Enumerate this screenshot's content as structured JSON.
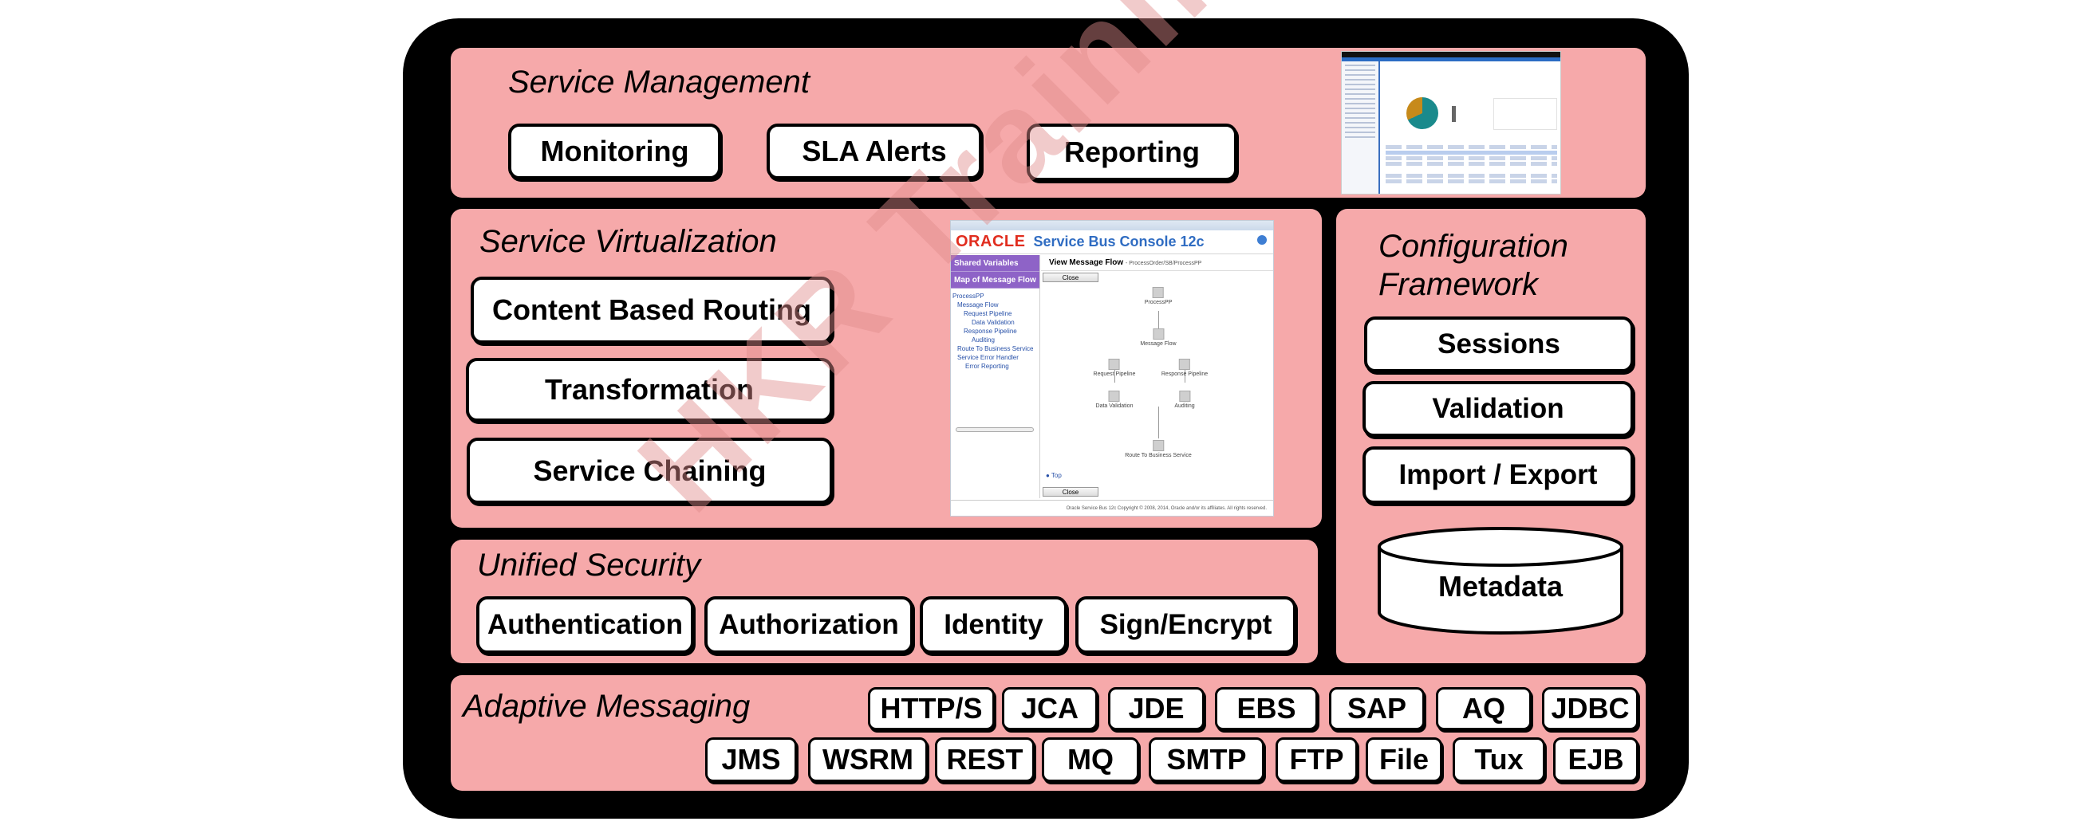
{
  "watermark": "HKR Trainings",
  "colors": {
    "frame": "#000000",
    "panel": "#f6a9aa",
    "box": "#ffffff"
  },
  "service_management": {
    "title": "Service Management",
    "items": [
      "Monitoring",
      "SLA Alerts",
      "Reporting"
    ],
    "screenshot": {
      "description": "Enterprise Manager dashboard with pie chart",
      "pie_colors": [
        "#1a8a8c",
        "#c78a1a"
      ]
    }
  },
  "service_virtualization": {
    "title": "Service Virtualization",
    "items": [
      "Content Based Routing",
      "Transformation",
      "Service Chaining"
    ],
    "screenshot": {
      "vendor_logo": "ORACLE",
      "app_title": "Service Bus Console 12c",
      "nav_tabs": [
        "Shared Variables",
        "Map of Message Flow"
      ],
      "tree": [
        "ProcessPP",
        "Message Flow",
        "Request Pipeline",
        "Data Validation",
        "Response Pipeline",
        "Auditing",
        "Route To Business Service",
        "Service Error Handler",
        "Error Reporting"
      ],
      "view_title": "View Message Flow",
      "view_path": "- ProcessOrder/SB/ProcessPP",
      "close_button": "Close",
      "nodes": [
        "ProcessPP",
        "Message Flow",
        "Request Pipeline",
        "Response Pipeline",
        "Data Validation",
        "Auditing",
        "Route To Business Service"
      ],
      "top_link": "Top",
      "footer": "Oracle Service Bus 12c Copyright © 2008, 2014, Oracle and/or its affiliates. All rights reserved."
    }
  },
  "configuration_framework": {
    "title_line1": "Configuration",
    "title_line2": "Framework",
    "items": [
      "Sessions",
      "Validation",
      "Import / Export"
    ],
    "repository": "Metadata"
  },
  "unified_security": {
    "title": "Unified Security",
    "items": [
      "Authentication",
      "Authorization",
      "Identity",
      "Sign/Encrypt"
    ]
  },
  "adaptive_messaging": {
    "title": "Adaptive Messaging",
    "row1": [
      "HTTP/S",
      "JCA",
      "JDE",
      "EBS",
      "SAP",
      "AQ",
      "JDBC"
    ],
    "row2": [
      "JMS",
      "WSRM",
      "REST",
      "MQ",
      "SMTP",
      "FTP",
      "File",
      "Tux",
      "EJB"
    ]
  }
}
